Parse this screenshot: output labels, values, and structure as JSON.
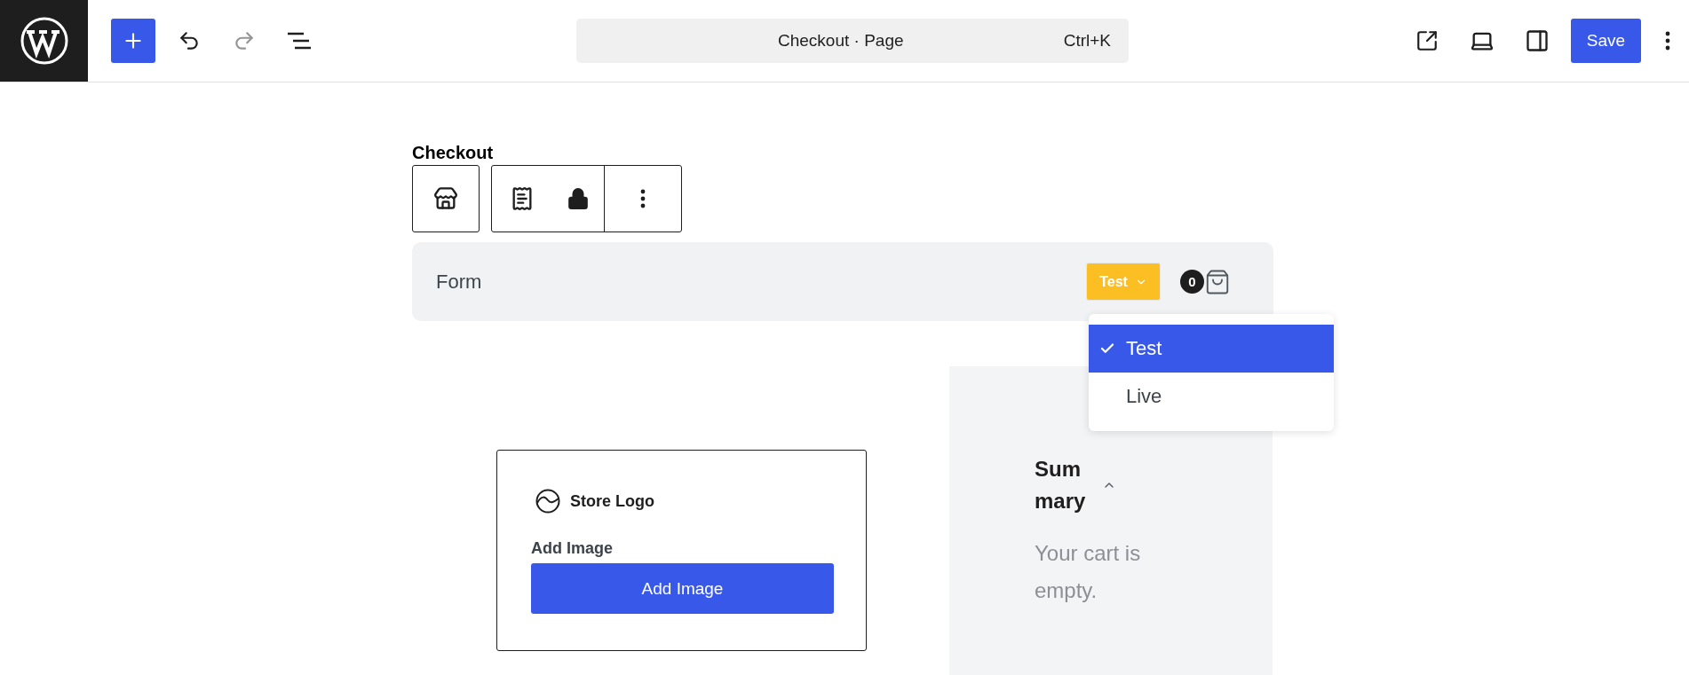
{
  "top_bar": {
    "undo": {
      "disabled": false
    },
    "redo": {
      "disabled": true
    },
    "command_bar": {
      "title": "Checkout · Page",
      "shortcut": "Ctrl+K"
    },
    "save_button": "Save"
  },
  "page_title": "Checkout",
  "form": {
    "label": "Form",
    "mode_button": "Test",
    "cart_count": "0",
    "mode_menu": [
      {
        "label": "Test",
        "selected": true
      },
      {
        "label": "Live",
        "selected": false
      }
    ]
  },
  "store_logo": {
    "label": "Store Logo",
    "field_label": "Add Image",
    "button": "Add Image"
  },
  "summary": {
    "title": "Summary",
    "expanded": true,
    "empty_message": "Your cart is empty."
  }
}
